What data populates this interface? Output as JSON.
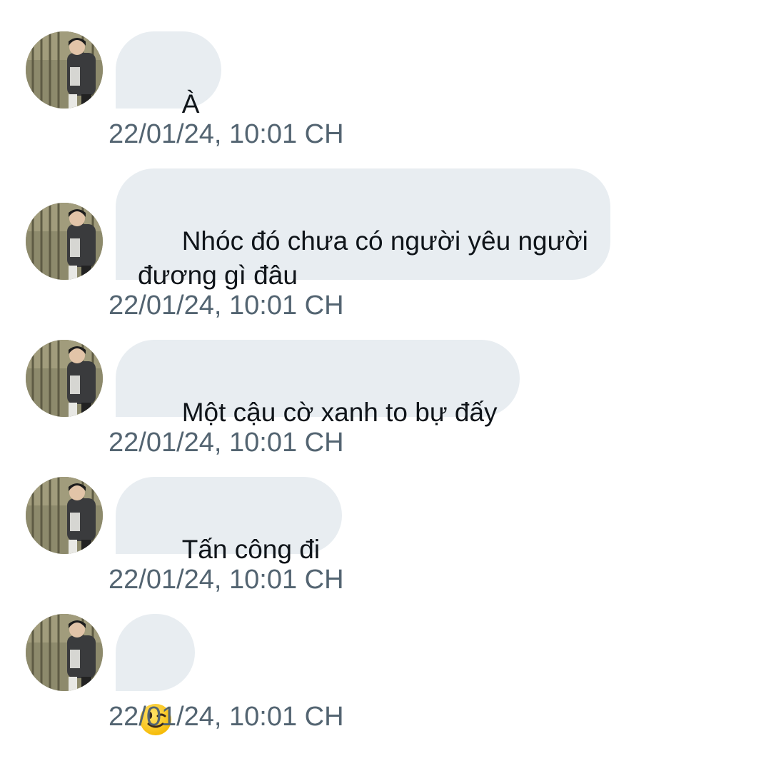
{
  "messages": [
    {
      "text": "À",
      "timestamp": "22/01/24, 10:01 CH"
    },
    {
      "text": "Nhóc đó chưa có người yêu người\nđương gì đâu",
      "timestamp": "22/01/24, 10:01 CH"
    },
    {
      "text": "Một cậu cờ xanh to bự đấy",
      "timestamp": "22/01/24, 10:01 CH"
    },
    {
      "text": "Tấn công đi",
      "timestamp": "22/01/24, 10:01 CH"
    },
    {
      "emoji": "winking-face",
      "timestamp": "22/01/24, 10:01 CH"
    }
  ],
  "colors": {
    "bubble_bg": "#e8edf1",
    "text": "#0f1419",
    "timestamp": "#536471"
  }
}
